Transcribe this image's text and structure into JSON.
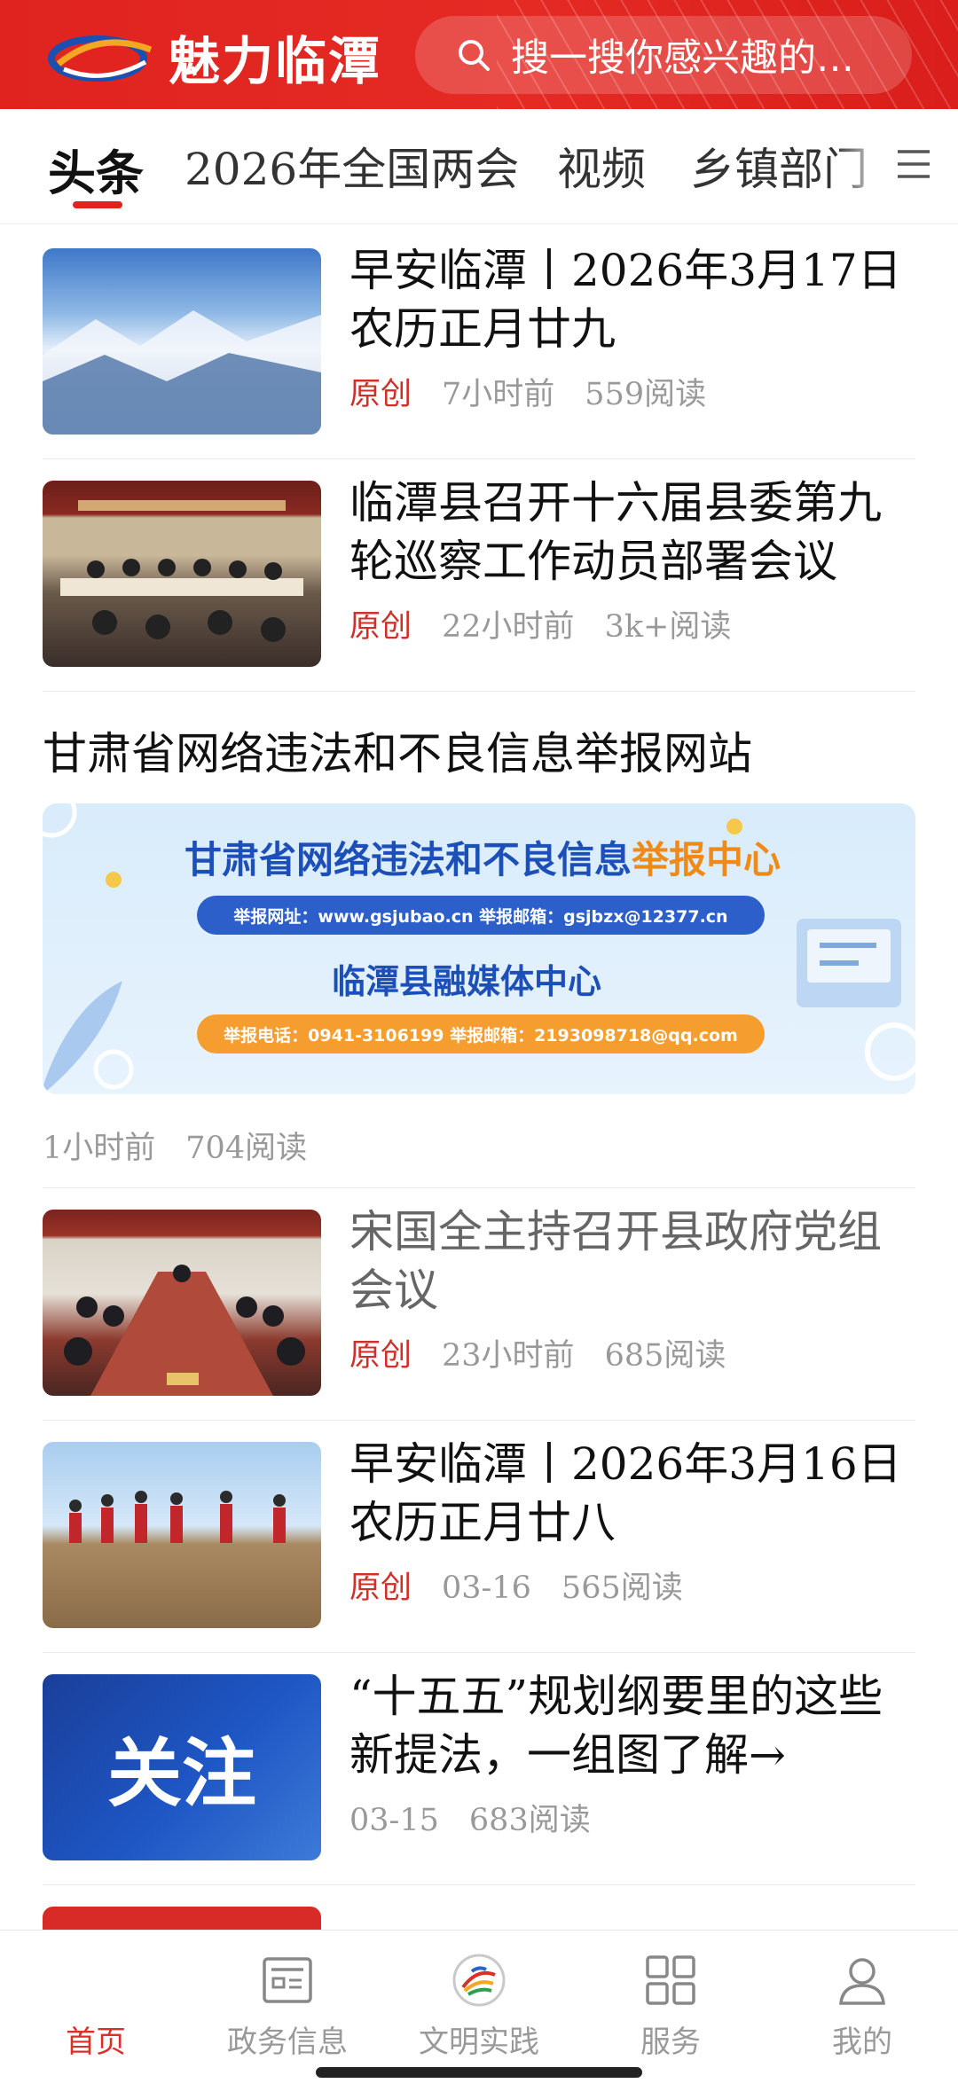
{
  "header": {
    "app_title": "魅力临潭",
    "search_placeholder": "搜一搜你感兴趣的…",
    "brand_color": "#e0231f"
  },
  "tabs": {
    "items": [
      {
        "label": "头条",
        "active": true
      },
      {
        "label": "2026年全国两会"
      },
      {
        "label": "视频"
      },
      {
        "label": "乡镇部门"
      }
    ],
    "menu_icon": "hamburger-icon"
  },
  "feed": [
    {
      "title": "早安临潭丨2026年3月17日农历正月廿九",
      "tag": "原创",
      "time": "7小时前",
      "reads": "559阅读"
    },
    {
      "title": "临潭县召开十六届县委第九轮巡察工作动员部署会议",
      "tag": "原创",
      "time": "22小时前",
      "reads": "3k+阅读"
    },
    {
      "title": "宋国全主持召开县政府党组会议",
      "tag": "原创",
      "time": "23小时前",
      "reads": "685阅读"
    },
    {
      "title": "早安临潭丨2026年3月16日农历正月廿八",
      "tag": "原创",
      "time": "03-16",
      "reads": "565阅读"
    },
    {
      "title": "“十五五”规划纲要里的这些新提法，一组图了解→",
      "time": "03-15",
      "reads": "683阅读",
      "thumb_text": "关注"
    }
  ],
  "banner": {
    "title": "甘肃省网络违法和不良信息举报网站",
    "line1_main": "甘肃省网络违法和不良信息",
    "line1_highlight": "举报中心",
    "pill1": "举报网址：www.gsjubao.cn  举报邮箱：gsjbzx@12377.cn",
    "line2": "临潭县融媒体中心",
    "pill2": "举报电话：0941-3106199  举报邮箱：2193098718@qq.com",
    "time": "1小时前",
    "reads": "704阅读"
  },
  "bottom_nav": [
    {
      "label": "首页",
      "icon": "home-icon",
      "active": true
    },
    {
      "label": "政务信息",
      "icon": "news-icon"
    },
    {
      "label": "文明实践",
      "icon": "civilization-logo-icon"
    },
    {
      "label": "服务",
      "icon": "grid-icon"
    },
    {
      "label": "我的",
      "icon": "user-icon"
    }
  ]
}
